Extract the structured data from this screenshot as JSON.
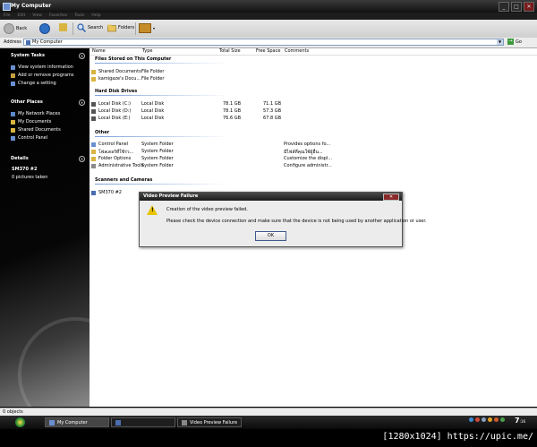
{
  "window": {
    "title": "My Computer",
    "menu": [
      "File",
      "Edit",
      "View",
      "Favorites",
      "Tools",
      "Help"
    ],
    "buttons": [
      "_",
      "□",
      "✕"
    ]
  },
  "toolbar": {
    "back_label": "Back",
    "search_label": "Search",
    "folders_label": "Folders"
  },
  "address": {
    "label": "Address",
    "value": "My Computer",
    "go_label": "Go"
  },
  "sidebar": {
    "system_tasks": {
      "title": "System Tasks",
      "items": [
        "View system information",
        "Add or remove programs",
        "Change a setting"
      ]
    },
    "other_places": {
      "title": "Other Places",
      "items": [
        "My Network Places",
        "My Documents",
        "Shared Documents",
        "Control Panel"
      ]
    },
    "details": {
      "title": "Details",
      "name": "SM370 #2",
      "info": "0 pictures taken"
    }
  },
  "columns": {
    "name": "Name",
    "type": "Type",
    "total": "Total Size",
    "free": "Free Space",
    "comments": "Comments"
  },
  "groups": {
    "files": {
      "title": "Files Stored on This Computer",
      "rows": [
        {
          "name": "Shared Documents",
          "type": "File Folder"
        },
        {
          "name": "kamigaze's Docu...",
          "type": "File Folder"
        }
      ]
    },
    "drives": {
      "title": "Hard Disk Drives",
      "rows": [
        {
          "name": "Local Disk (C:)",
          "type": "Local Disk",
          "total": "78.1 GB",
          "free": "71.1 GB"
        },
        {
          "name": "Local Disk (D:)",
          "type": "Local Disk",
          "total": "78.1 GB",
          "free": "57.3 GB"
        },
        {
          "name": "Local Disk (E:)",
          "type": "Local Disk",
          "total": "76.6 GB",
          "free": "67.8 GB"
        }
      ]
    },
    "other": {
      "title": "Other",
      "rows": [
        {
          "name": "Control Panel",
          "type": "System Folder",
          "comment": "Provides options fo..."
        },
        {
          "name": "โฟลเดอร์ที่ใช้ร่ว...",
          "type": "System Folder",
          "comment": "มีไฟล์ที่คุณใช้ผู้อื่น..."
        },
        {
          "name": "Folder Options",
          "type": "System Folder",
          "comment": "Customize the displ..."
        },
        {
          "name": "Administrative Tools",
          "type": "System Folder",
          "comment": "Configure administr..."
        }
      ]
    },
    "scanners": {
      "title": "Scanners and Cameras",
      "rows": [
        {
          "name": "SM370 #2"
        }
      ]
    }
  },
  "dialog": {
    "title": "Video Preview Failure",
    "close_label": "✕",
    "warning_symbol": "!",
    "message1": "Creation of the video preview failed.",
    "message2": "Please check the device connection and make sure that the device is not being used by another application or user.",
    "ok_label": "OK"
  },
  "status": {
    "text": "0 objects"
  },
  "taskbar": {
    "tasks": [
      "My Computer",
      "",
      "Video Preview Failure"
    ],
    "clock": "7",
    "clock_suffix": ":16"
  },
  "watermark": "[1280x1024] https://upic.me/",
  "colors": {
    "sidebar_bg": "#000000",
    "accent_blue": "#2f6fc4",
    "warning_yellow": "#e6c200",
    "close_red": "#8a2a2a"
  }
}
